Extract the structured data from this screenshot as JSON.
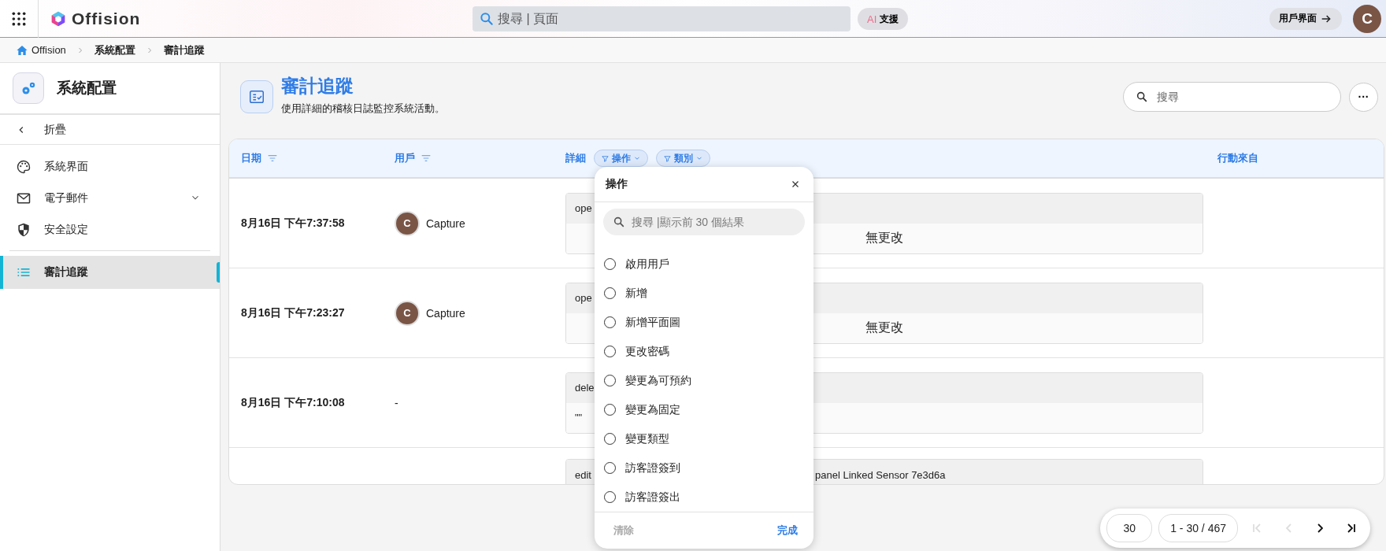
{
  "top_bar": {
    "brand": "Offision",
    "search": {
      "placeholder": "搜尋 | 頁面"
    },
    "ai_button": {
      "badge": "AI",
      "label": "支援"
    },
    "user_view_button": "用戶界面",
    "avatar": "C"
  },
  "breadcrumb": [
    "Offision",
    "系統配置",
    "審計追蹤"
  ],
  "sidebar": {
    "title": "系統配置",
    "collapse": "折疊",
    "items": [
      {
        "label": "系統界面",
        "selected": false
      },
      {
        "label": "電子郵件",
        "selected": false,
        "expanded": false
      },
      {
        "label": "安全設定",
        "selected": false
      },
      {
        "label": "審計追蹤",
        "selected": true
      }
    ]
  },
  "page": {
    "title": "審計追蹤",
    "subtitle": "使用詳細的稽核日誌監控系統活動。",
    "search": {
      "placeholder": "搜尋"
    },
    "more_button": "···"
  },
  "table": {
    "columns": [
      {
        "label": "日期",
        "filter": true
      },
      {
        "label": "用戶",
        "filter": true
      },
      {
        "label": "詳細",
        "filter": false
      },
      {
        "label": "行動來自",
        "filter": false
      }
    ],
    "detail_chips": [
      "操作",
      "類別"
    ],
    "rows": [
      {
        "date": "8月16日 下午7:37:58",
        "user": {
          "avatar": "C",
          "name": "Capture"
        },
        "summary": [
          "ope"
        ],
        "no_change": "無更改"
      },
      {
        "date": "8月16日 下午7:23:27",
        "user": {
          "avatar": "C",
          "name": "Capture"
        },
        "summary": [
          "ope"
        ],
        "no_change": "無更改"
      },
      {
        "date": "8月16日 下午7:10:08",
        "user": {
          "name": "-"
        },
        "summary": [
          "dele"
        ],
        "value": "\"\""
      },
      {
        "summary": [
          "edit",
          "panel Linked Sensor 7e3d6a"
        ]
      }
    ]
  },
  "filter_popup": {
    "title": "操作",
    "search": {
      "placeholder": "搜尋 |顯示前 30 個結果"
    },
    "options": [
      {
        "label": "啟用用戶",
        "selected": false
      },
      {
        "label": "新增",
        "selected": false
      },
      {
        "label": "新增平面圖",
        "selected": false
      },
      {
        "label": "更改密碼",
        "selected": false
      },
      {
        "label": "變更為可預約",
        "selected": false
      },
      {
        "label": "變更為固定",
        "selected": false
      },
      {
        "label": "變更類型",
        "selected": false
      },
      {
        "label": "訪客證簽到",
        "selected": false
      },
      {
        "label": "訪客證簽出",
        "selected": false
      }
    ],
    "clear_button": "清除",
    "done_button": "完成"
  },
  "pager": {
    "page_size": "30",
    "range": "1 - 30 / 467",
    "nav": [
      {
        "disabled": true
      },
      {
        "disabled": true
      },
      {
        "disabled": false
      },
      {
        "disabled": false
      }
    ]
  }
}
